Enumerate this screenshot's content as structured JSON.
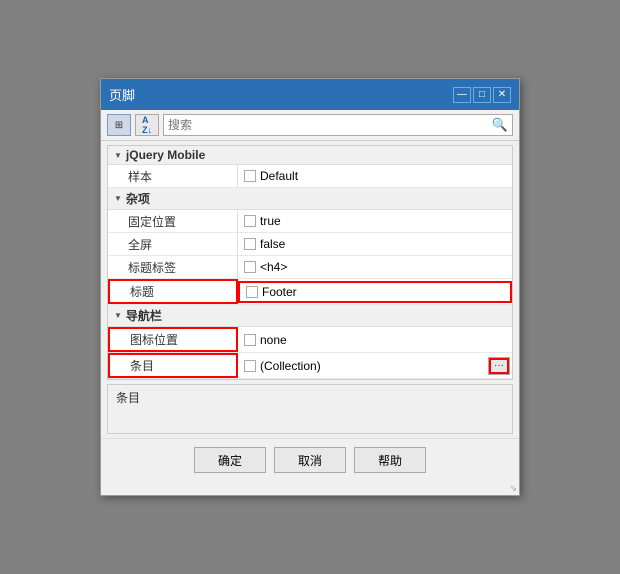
{
  "dialog": {
    "title": "页脚",
    "min_label": "—",
    "max_label": "□",
    "close_label": "✕"
  },
  "toolbar": {
    "icon1_label": "⊞",
    "icon2_label": "AZ↓",
    "search_placeholder": "搜索"
  },
  "search": {
    "icon": "🔍"
  },
  "sections": [
    {
      "id": "jquery-mobile",
      "label": "jQuery Mobile",
      "rows": [
        {
          "name": "样本",
          "value": "Default",
          "highlighted_name": false,
          "highlighted_value": false
        }
      ]
    },
    {
      "id": "misc",
      "label": "杂项",
      "rows": [
        {
          "name": "固定位置",
          "value": "true",
          "highlighted_name": false,
          "highlighted_value": false
        },
        {
          "name": "全屏",
          "value": "false",
          "highlighted_name": false,
          "highlighted_value": false
        },
        {
          "name": "标题标签",
          "value": "<h4>",
          "highlighted_name": false,
          "highlighted_value": false
        },
        {
          "name": "标题",
          "value": "Footer",
          "highlighted_name": true,
          "highlighted_value": true
        }
      ]
    },
    {
      "id": "nav",
      "label": "导航栏",
      "rows": [
        {
          "name": "图标位置",
          "value": "none",
          "highlighted_name": true,
          "highlighted_value": false
        },
        {
          "name": "条目",
          "value": "(Collection)",
          "highlighted_name": true,
          "highlighted_value": false,
          "has_ellipsis": true
        }
      ]
    }
  ],
  "bottom_panel": {
    "label": "条目"
  },
  "footer": {
    "confirm": "确定",
    "cancel": "取消",
    "help": "帮助"
  }
}
